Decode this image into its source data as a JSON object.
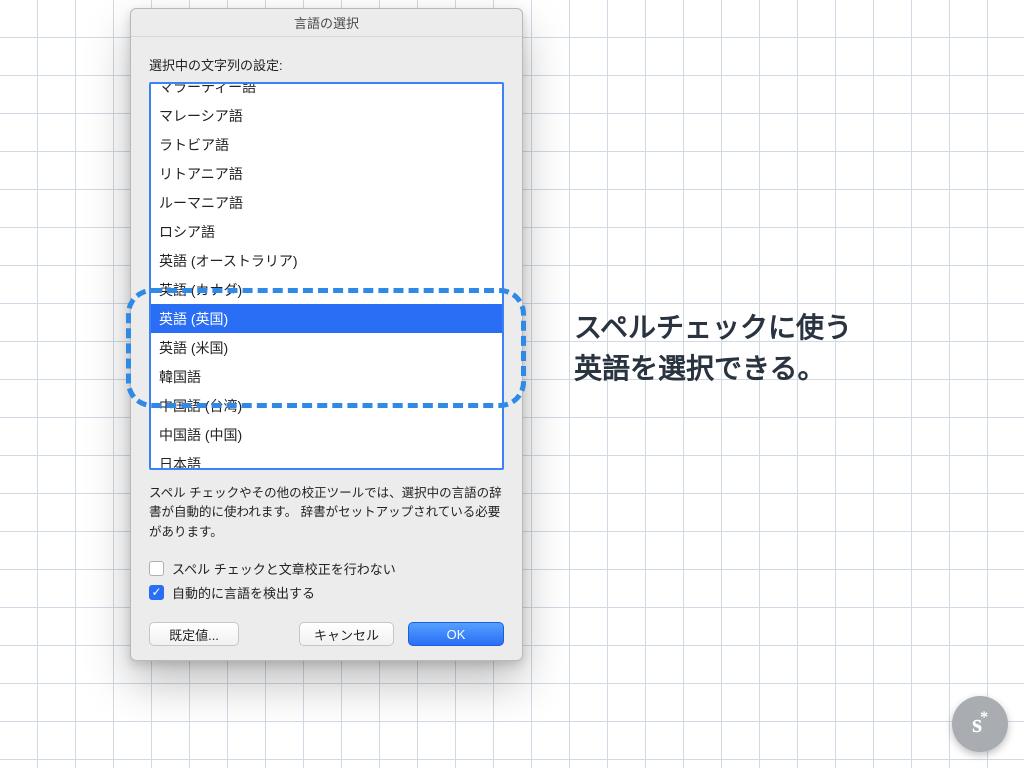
{
  "dialog": {
    "title": "言語の選択",
    "list_heading": "選択中の文字列の設定:",
    "languages": [
      "マラーティー語",
      "マレーシア語",
      "ラトビア語",
      "リトアニア語",
      "ルーマニア語",
      "ロシア語",
      "英語 (オーストラリア)",
      "英語 (カナダ)",
      "英語 (英国)",
      "英語 (米国)",
      "韓国語",
      "中国語 (台湾)",
      "中国語 (中国)",
      "日本語"
    ],
    "selected_index": 8,
    "help_text": "スペル チェックやその他の校正ツールでは、選択中の言語の辞書が自動的に使われます。 辞書がセットアップされている必要があります。",
    "checkbox_skip": {
      "label": "スペル チェックと文章校正を行わない",
      "checked": false
    },
    "checkbox_autodetect": {
      "label": "自動的に言語を検出する",
      "checked": true
    },
    "buttons": {
      "default": "既定値...",
      "cancel": "キャンセル",
      "ok": "OK"
    }
  },
  "annotation": {
    "line1": "スペルチェックに使う",
    "line2": "英語を選択できる。"
  },
  "badge": "s*"
}
